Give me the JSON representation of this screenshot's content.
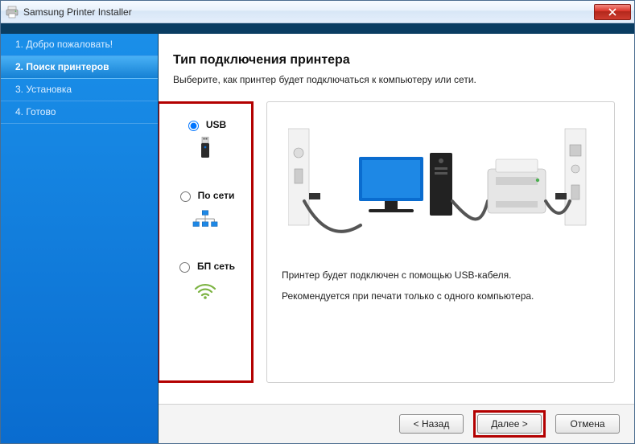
{
  "window": {
    "title": "Samsung Printer Installer"
  },
  "sidebar": {
    "steps": [
      "1. Добро пожаловать!",
      "2. Поиск принтеров",
      "3. Установка",
      "4. Готово"
    ],
    "active_index": 1
  },
  "main": {
    "heading": "Тип подключения принтера",
    "subtitle": "Выберите, как принтер будет подключаться к компьютеру или сети."
  },
  "options": {
    "usb": {
      "label": "USB",
      "selected": true
    },
    "network": {
      "label": "По сети",
      "selected": false
    },
    "wireless": {
      "label": "БП сеть",
      "selected": false
    }
  },
  "info": {
    "line1": "Принтер будет подключен с помощью USB-кабеля.",
    "line2": "Рекомендуется при печати только с одного компьютера."
  },
  "footer": {
    "back": "< Назад",
    "next": "Далее >",
    "cancel": "Отмена"
  }
}
